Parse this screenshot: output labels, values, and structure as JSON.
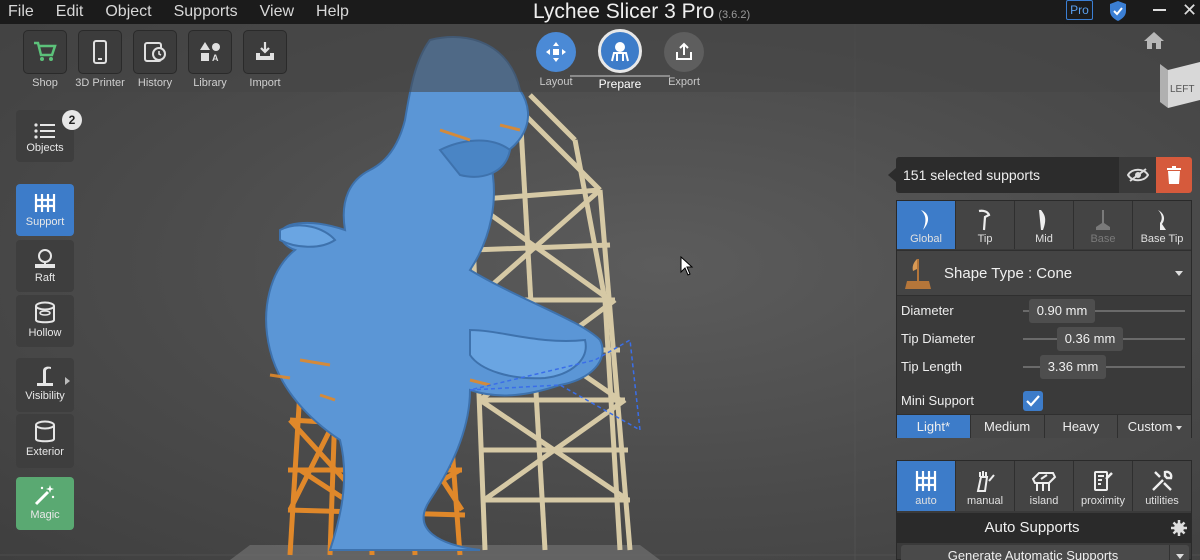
{
  "menubar": {
    "items": [
      "File",
      "Edit",
      "Object",
      "Supports",
      "View",
      "Help"
    ],
    "title": "Lychee Slicer 3 Pro",
    "version": "(3.6.2)",
    "pro_badge": "Pro"
  },
  "toolbar": {
    "tools": [
      {
        "label": "Shop",
        "icon": "cart-icon"
      },
      {
        "label": "3D Printer",
        "icon": "phone-icon"
      },
      {
        "label": "History",
        "icon": "history-icon"
      },
      {
        "label": "Library",
        "icon": "shapes-icon"
      },
      {
        "label": "Import",
        "icon": "import-icon"
      }
    ],
    "steps": [
      {
        "label": "Layout",
        "icon": "move-arrows-icon"
      },
      {
        "label": "Prepare",
        "icon": "support-person-icon",
        "active": true
      },
      {
        "label": "Export",
        "icon": "upload-icon"
      }
    ]
  },
  "sidebar": {
    "objects": {
      "label": "Objects",
      "count": "2"
    },
    "items": [
      {
        "label": "Support",
        "icon": "support-icon",
        "active": true
      },
      {
        "label": "Raft",
        "icon": "raft-icon"
      },
      {
        "label": "Hollow",
        "icon": "hollow-icon"
      },
      {
        "label": "Visibility",
        "icon": "visibility-icon"
      },
      {
        "label": "Exterior",
        "icon": "exterior-icon"
      },
      {
        "label": "Magic",
        "icon": "magic-wand-icon"
      }
    ]
  },
  "selection": {
    "text": "151 selected supports"
  },
  "support_panel": {
    "tabs": [
      {
        "label": "Global",
        "active": true
      },
      {
        "label": "Tip"
      },
      {
        "label": "Mid"
      },
      {
        "label": "Base",
        "disabled": true
      },
      {
        "label": "Base Tip"
      }
    ],
    "shape_type": "Shape Type : Cone",
    "params": [
      {
        "label": "Diameter",
        "value": "0.90 mm"
      },
      {
        "label": "Tip Diameter",
        "value": "0.36 mm"
      },
      {
        "label": "Tip Length",
        "value": "3.36 mm"
      }
    ],
    "mini_support": {
      "label": "Mini Support",
      "checked": true
    },
    "density": [
      "Light*",
      "Medium",
      "Heavy",
      "Custom"
    ],
    "density_active": "Light*"
  },
  "auto_panel": {
    "tabs": [
      {
        "label": "auto",
        "active": true
      },
      {
        "label": "manual"
      },
      {
        "label": "island"
      },
      {
        "label": "proximity"
      },
      {
        "label": "utilities"
      }
    ],
    "title": "Auto Supports",
    "generate_label": "Generate Automatic Supports"
  },
  "colors": {
    "accent": "#3d7cc9",
    "model": "#5b96d6",
    "support_selected": "#e08a2c",
    "support_other": "#d8ccaa",
    "delete": "#d65a3c",
    "magic": "#5aa972"
  }
}
